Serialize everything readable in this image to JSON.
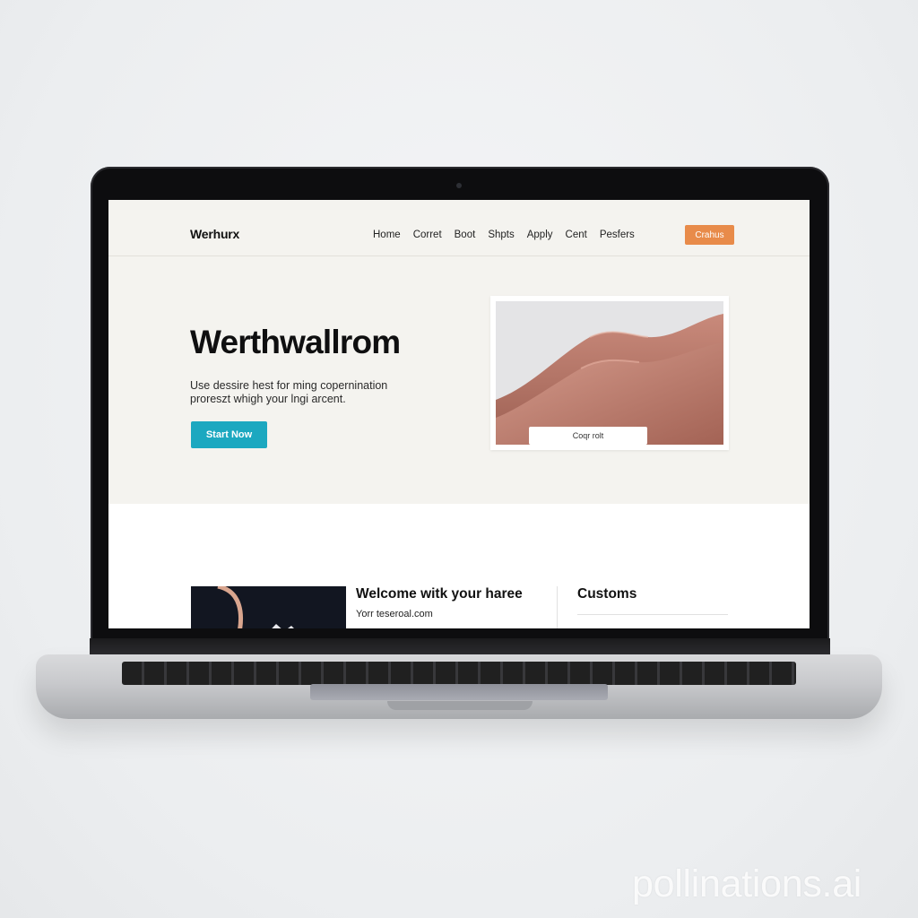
{
  "site": {
    "logo": "Werhurx",
    "nav": [
      "Home",
      "Corret",
      "Boot",
      "Shpts",
      "Apply",
      "Cent",
      "Pesfers"
    ],
    "header_button": "Crahus"
  },
  "hero": {
    "title": "Werthwallrom",
    "subtitle": "Use dessire hest for ming copernination proreszt whigh your lngi arcent.",
    "button": "Start Now",
    "image_caption_button": "Coqr rolt"
  },
  "lower": {
    "welcome_title": "Welcome witk your haree",
    "email": "Yorr teseroal.com",
    "side_title": "Customs"
  },
  "watermark": "pollinations.ai",
  "colors": {
    "header_button": "#e88b4a",
    "hero_button": "#1ca8c0",
    "hero_bg": "#f4f3ef",
    "fabric": "#b8786a"
  }
}
